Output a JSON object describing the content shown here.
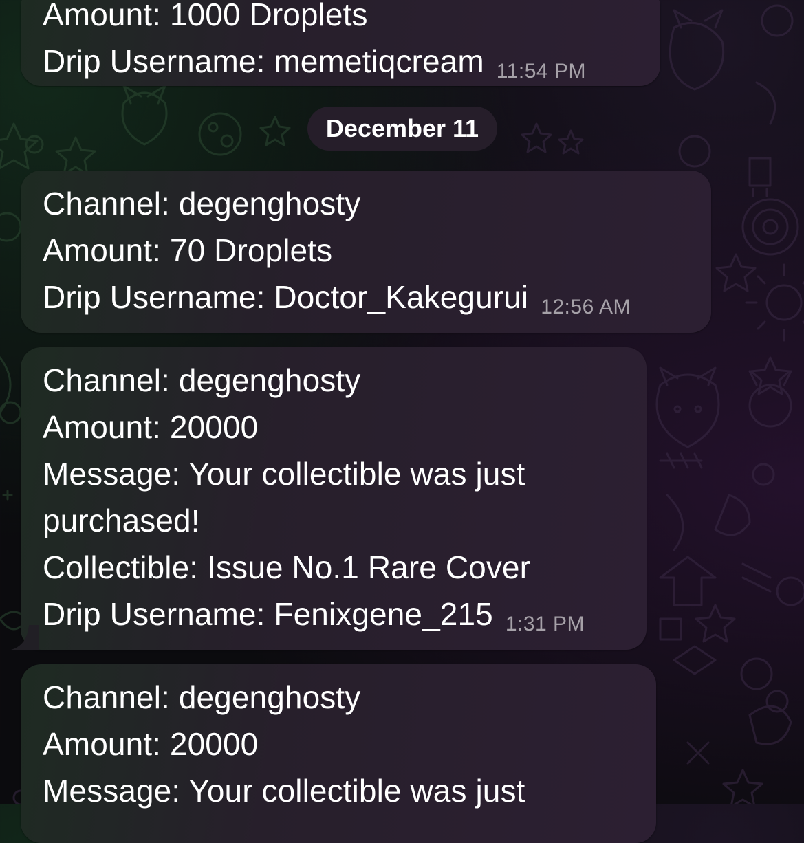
{
  "chat": {
    "date_separator": "December 11",
    "messages": [
      {
        "lines": [
          "Amount: 1000 Droplets",
          "Drip Username: memetiqcream"
        ],
        "time": "11:54 PM"
      },
      {
        "lines": [
          "Channel: degenghosty",
          "Amount: 70 Droplets",
          "Drip Username: Doctor_Kakegurui"
        ],
        "time": "12:56 AM"
      },
      {
        "lines": [
          "Channel: degenghosty",
          "Amount: 20000",
          "Message: Your collectible was just",
          "purchased!",
          "Collectible: Issue No.1 Rare Cover",
          "Drip Username: Fenixgene_215"
        ],
        "time": "1:31 PM"
      },
      {
        "lines": [
          "Channel: degenghosty",
          "Amount: 20000",
          "Message: Your collectible was just"
        ],
        "time": ""
      }
    ]
  }
}
